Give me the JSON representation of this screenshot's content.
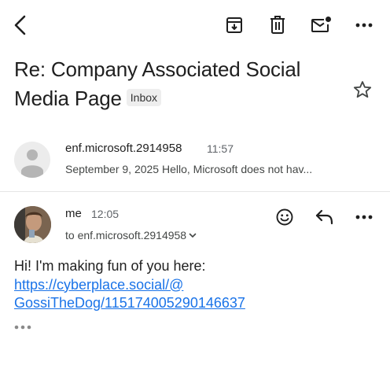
{
  "toolbar": {
    "back_icon": "chevron-left-icon",
    "archive_icon": "archive-icon",
    "delete_icon": "trash-icon",
    "unread_icon": "mark-unread-icon",
    "more_icon": "more-horizontal-icon"
  },
  "subject": {
    "title": "Re: Company Associated Social Media Page",
    "label": "Inbox"
  },
  "messages": [
    {
      "sender": "enf.microsoft.2914958",
      "time": "11:57",
      "snippet": "September 9, 2025 Hello, Microsoft does not hav..."
    },
    {
      "sender": "me",
      "time": "12:05",
      "to": "to enf.microsoft.2914958",
      "body_text": "Hi! I'm making fun of you here:",
      "link_line1": "https://cyberplace.social/@",
      "link_line2": "GossiTheDog/115174005290146637"
    }
  ],
  "colors": {
    "link": "#1a73e8",
    "text": "#1f1f1f",
    "muted": "#5f6368"
  }
}
